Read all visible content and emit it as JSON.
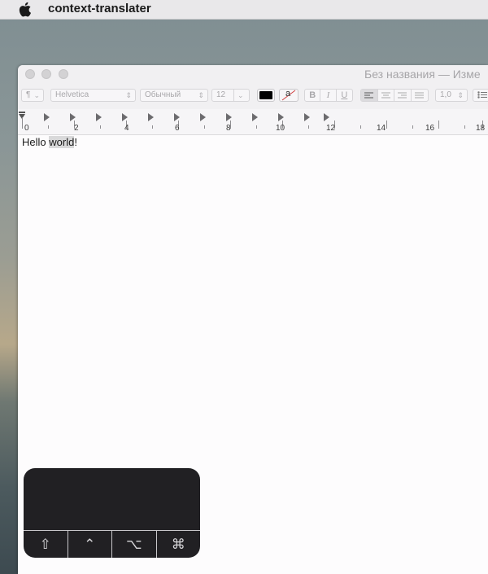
{
  "menubar": {
    "app_name": "context-translater",
    "apple_icon": "apple-logo-icon"
  },
  "window": {
    "title": "Без названия — Изме",
    "toolbar": {
      "paragraph_style": "¶",
      "font_family": "Helvetica",
      "font_style": "Обычный",
      "font_size": "12",
      "text_color": "#000000",
      "background_color_glyph": "a",
      "bold": "B",
      "italic": "I",
      "underline": "U",
      "line_spacing": "1,0"
    },
    "ruler": {
      "labels": [
        "0",
        "2",
        "4",
        "6",
        "8",
        "10",
        "12",
        "14",
        "16",
        "18"
      ]
    }
  },
  "document": {
    "text_before": "Hello ",
    "text_selected": "world",
    "text_after": "!"
  },
  "key_overlay": {
    "keys": [
      {
        "name": "shift-key-icon",
        "glyph": "⇧"
      },
      {
        "name": "control-key-icon",
        "glyph": "⌃"
      },
      {
        "name": "option-key-icon",
        "glyph": "⌥"
      },
      {
        "name": "command-key-icon",
        "glyph": "⌘"
      }
    ]
  }
}
